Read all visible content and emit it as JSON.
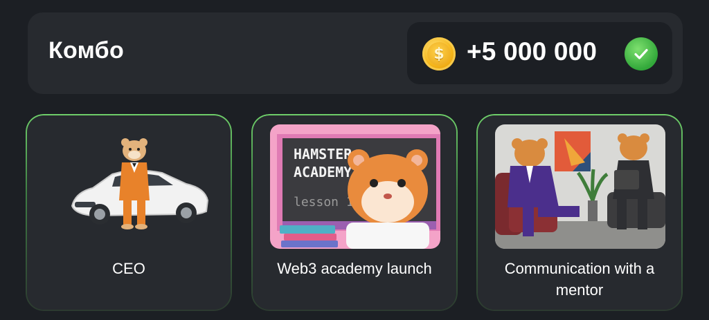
{
  "combo": {
    "title": "Комбо",
    "reward": "+5 000 000",
    "coin_icon": "coin-icon",
    "check_icon": "check-icon",
    "coin_symbol": "$"
  },
  "cards": [
    {
      "label": "CEO",
      "image": "hamster-ceo-with-car"
    },
    {
      "label": "Web3 academy launch",
      "image": "hamster-academy-lesson",
      "board_lines": [
        "HAMSTER",
        "ACADEMY",
        "lesson 1"
      ]
    },
    {
      "label": "Communication with a mentor",
      "image": "hamsters-mentor-meeting"
    }
  ],
  "colors": {
    "background": "#1c1f24",
    "panel": "#272a2f",
    "accent_green": "#6fcf6a",
    "coin_gold": "#f6b619"
  }
}
